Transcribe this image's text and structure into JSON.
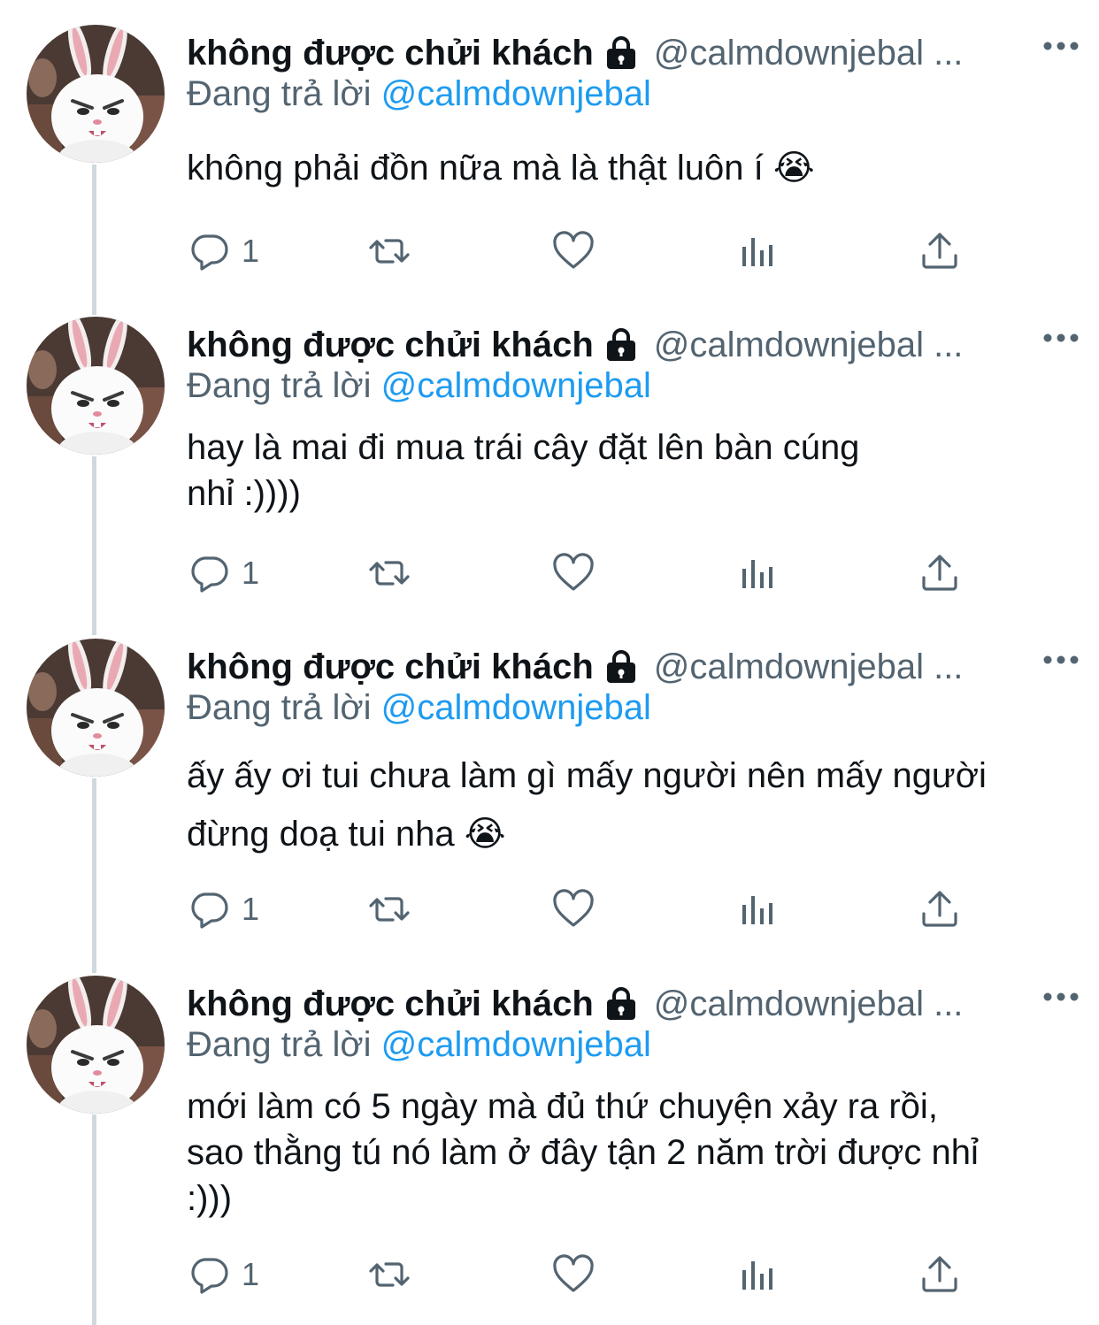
{
  "tweets": [
    {
      "name": "không được chửi khách",
      "handle": "@calmdownjebal ...",
      "replying_prefix": "Đang trả lời",
      "replying_to": "@calmdownjebal",
      "lines": [
        "không phải đồn nữa mà là thật luôn í"
      ],
      "emoji": "😭",
      "reply_count": "1"
    },
    {
      "name": "không được chửi khách",
      "handle": "@calmdownjebal ...",
      "replying_prefix": "Đang trả lời",
      "replying_to": "@calmdownjebal",
      "lines": [
        "hay là mai đi mua trái cây đặt lên bàn cúng",
        "nhỉ :))))"
      ],
      "emoji": "",
      "reply_count": "1"
    },
    {
      "name": "không được chửi khách",
      "handle": "@calmdownjebal ...",
      "replying_prefix": "Đang trả lời",
      "replying_to": "@calmdownjebal",
      "lines": [
        "ấy ấy ơi tui chưa làm gì mấy người nên mấy người",
        "đừng doạ tui nha"
      ],
      "emoji": "😭",
      "reply_count": "1"
    },
    {
      "name": "không được chửi khách",
      "handle": "@calmdownjebal ...",
      "replying_prefix": "Đang trả lời",
      "replying_to": "@calmdownjebal",
      "lines": [
        "mới làm có 5 ngày mà đủ thứ chuyện xảy ra rồi,",
        "sao thằng tú nó làm ở đây tận 2 năm trời được nhỉ",
        ":)))"
      ],
      "emoji": "",
      "reply_count": "1"
    }
  ],
  "icons": {
    "lock": "lock-icon",
    "more": "more-icon",
    "reply": "reply-icon",
    "retweet": "retweet-icon",
    "like": "heart-icon",
    "views": "views-icon",
    "share": "share-icon"
  },
  "colors": {
    "text": "#0f1419",
    "secondary": "#536471",
    "link": "#1d9bf0",
    "thread_line": "#cfd9de"
  }
}
